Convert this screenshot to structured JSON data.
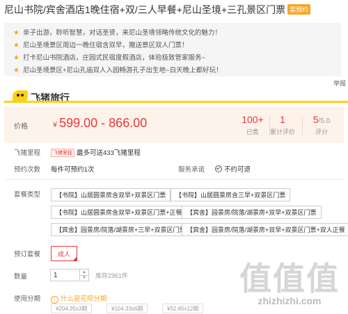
{
  "title": {
    "text": "尼山书院/宾舍酒店1晚住宿+双/三人早餐+尼山圣境+三孔景区门票",
    "badge": "需预约"
  },
  "features": [
    "亲子出游，聆听智慧，对话圣贤，来尼山圣境领略传统文化的魅力！",
    "尼山圣境景区周边一晚住宿含双早，赠送景区双人门票！",
    "打卡尼山书院酒店，庄园式民宿度假酒店，体验极致管家服务~",
    "尼山圣境景区+尼山孔庙双人入园畅游孔子出生地~白天晚上都好玩！"
  ],
  "report_label": "举报",
  "brand": {
    "name": "飞猪旅行"
  },
  "price": {
    "label": "价格",
    "currency": "¥",
    "range": "599.00 - 866.00",
    "stats": [
      {
        "value": "100+",
        "label": "已售"
      },
      {
        "value": "1",
        "label": "累计评价"
      },
      {
        "value": "5",
        "suffix": "/5.0",
        "label": "评分"
      }
    ]
  },
  "points": {
    "label": "飞猪里程",
    "badge": "飞猪里程",
    "text": "最多可送433飞猪里程"
  },
  "booking": {
    "label": "预约次数",
    "value": "每件可预约1次",
    "service_label": "服务承诺",
    "service_value": "不约可退"
  },
  "package": {
    "label": "套餐类型",
    "options": [
      "【书院】山居圆景房含双早+双景区门票",
      "【书院】山居圆景房含三早+双景区门票",
      "【书院】山居圆景房含双早+双景区门票+正餐",
      "【宾舍】园景房/院落/湖景房+双早+双景区门票",
      "【宾舍】园景房/院落/湖景房+三早+双景区门票",
      "【宾舍】园景房/院落/湖景房+双早+双景区门票+双人正餐"
    ]
  },
  "meal": {
    "label": "预订套餐",
    "option": "成人"
  },
  "quantity": {
    "label": "数量",
    "value": "1",
    "stock": "库存2961件"
  },
  "installment": {
    "label": "使用分期",
    "help": "什么是花呗分期",
    "options": [
      "¥204.35x3期",
      "¥104.33x6期",
      "¥52.65x12期"
    ]
  },
  "watermark": {
    "logo": "值值值",
    "site": "zhizhizhi.com"
  },
  "colors": {
    "accent": "#e4393c",
    "brand_yellow": "#ffd00f",
    "star": "#f5a623"
  }
}
